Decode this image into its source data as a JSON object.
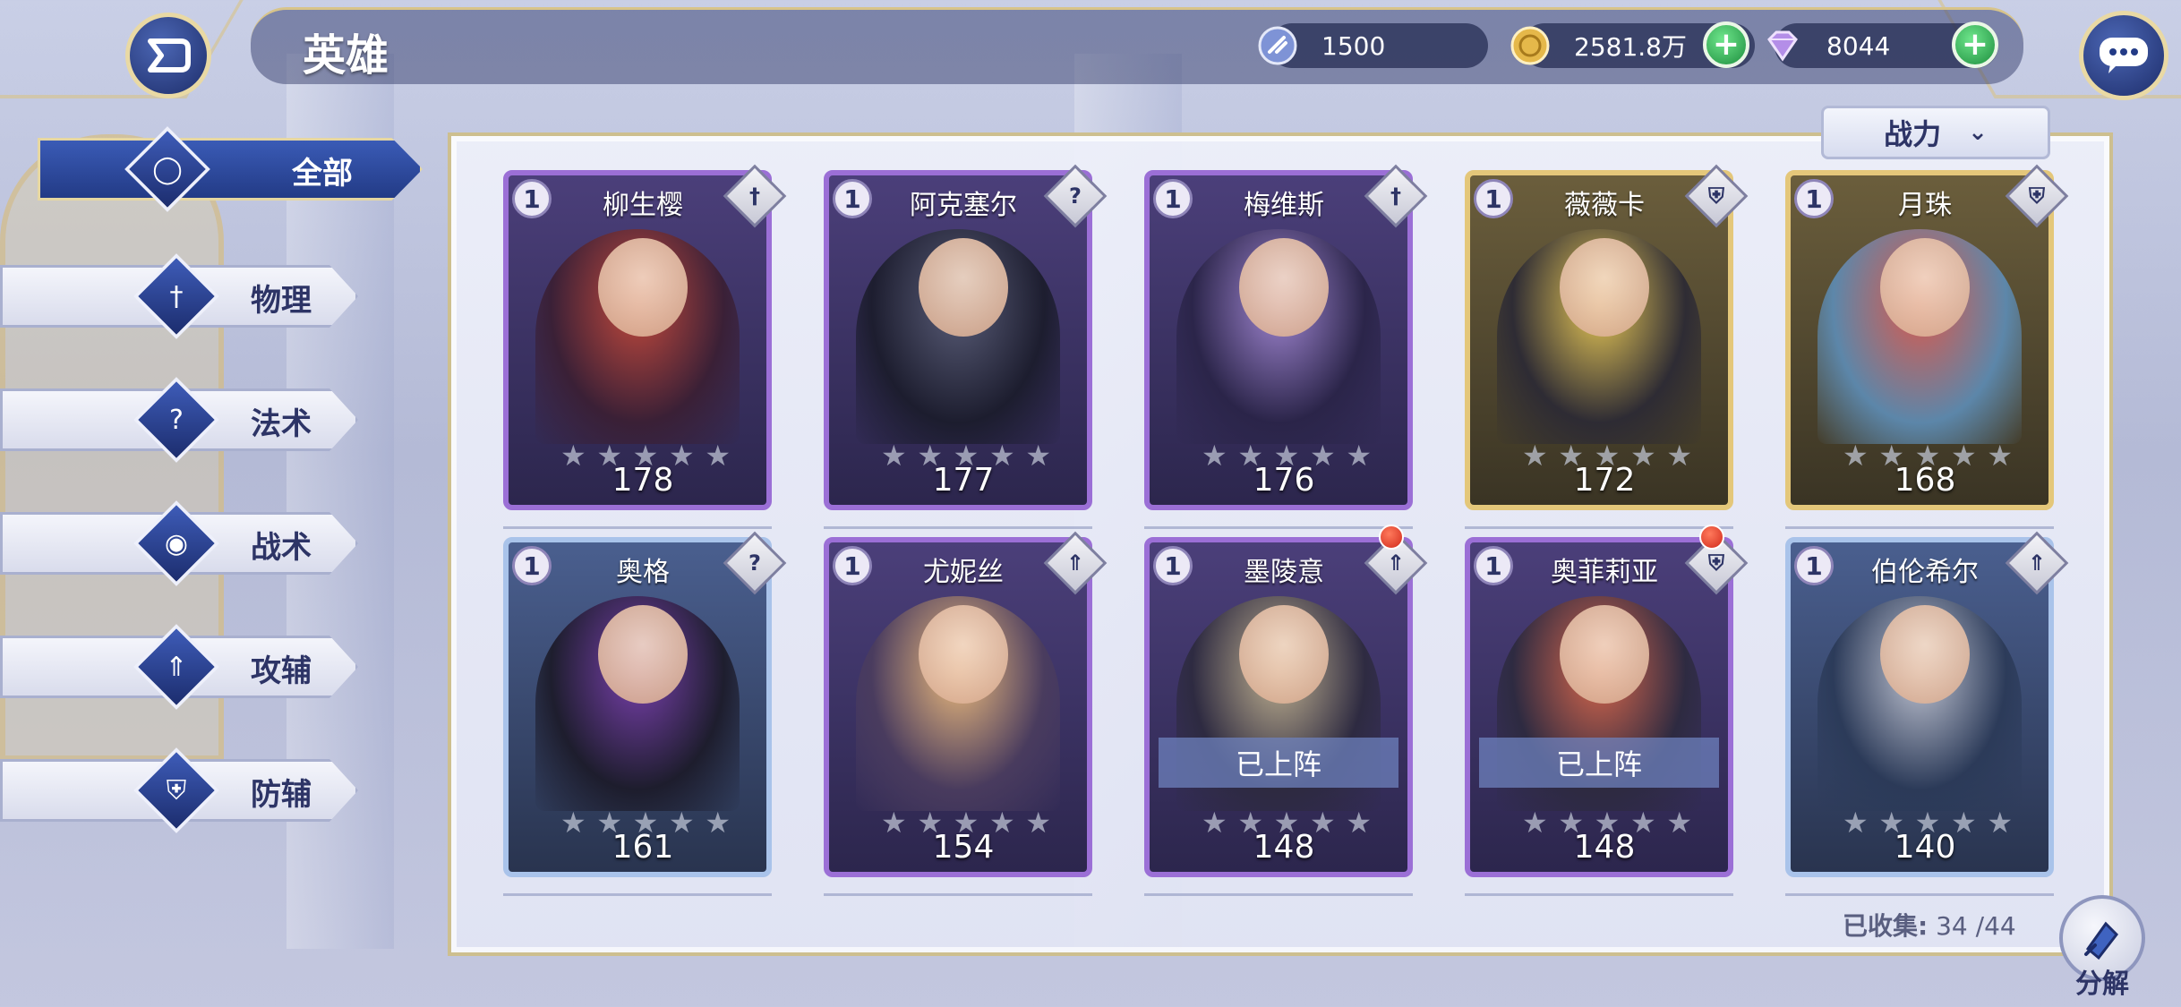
{
  "header": {
    "title": "英雄",
    "stamina": "1500",
    "gold": "2581.8万",
    "gems": "8044"
  },
  "sidebar": {
    "items": [
      {
        "label": "全部",
        "icon": "ring-icon"
      },
      {
        "label": "物理",
        "icon": "sword-icon"
      },
      {
        "label": "法术",
        "icon": "magic-icon"
      },
      {
        "label": "战术",
        "icon": "eye-icon"
      },
      {
        "label": "攻辅",
        "icon": "arrow-icon"
      },
      {
        "label": "防辅",
        "icon": "shield-icon"
      }
    ]
  },
  "sort": {
    "label": "战力"
  },
  "heroes": [
    {
      "name": "柳生樱",
      "level": "1",
      "power": "178",
      "frame": "purple",
      "class_icon": "sword-icon"
    },
    {
      "name": "阿克塞尔",
      "level": "1",
      "power": "177",
      "frame": "purple",
      "class_icon": "magic-icon"
    },
    {
      "name": "梅维斯",
      "level": "1",
      "power": "176",
      "frame": "purple",
      "class_icon": "sword-icon"
    },
    {
      "name": "薇薇卡",
      "level": "1",
      "power": "172",
      "frame": "gold",
      "class_icon": "shield-icon"
    },
    {
      "name": "月珠",
      "level": "1",
      "power": "168",
      "frame": "gold",
      "class_icon": "shield-icon"
    },
    {
      "name": "奥格",
      "level": "1",
      "power": "161",
      "frame": "blue",
      "class_icon": "magic-icon"
    },
    {
      "name": "尤妮丝",
      "level": "1",
      "power": "154",
      "frame": "purple",
      "class_icon": "arrow-icon"
    },
    {
      "name": "墨陵意",
      "level": "1",
      "power": "148",
      "frame": "purple",
      "class_icon": "arrow-icon",
      "status": "已上阵",
      "notify": true
    },
    {
      "name": "奥菲莉亚",
      "level": "1",
      "power": "148",
      "frame": "purple",
      "class_icon": "shield-icon",
      "status": "已上阵",
      "notify": true
    },
    {
      "name": "伯伦希尔",
      "level": "1",
      "power": "140",
      "frame": "blue",
      "class_icon": "arrow-icon"
    }
  ],
  "footer": {
    "collected_label": "已收集:",
    "collected_value": "34 /44",
    "decompose_label": "分解"
  },
  "colors": {
    "accent_blue": "#233b86",
    "gold_trim": "#d9c488",
    "purple_frame": "#9b6fd6",
    "gold_frame": "#e4c77a",
    "blue_frame": "#a9c3ea",
    "notify_red": "#d12a1b"
  }
}
